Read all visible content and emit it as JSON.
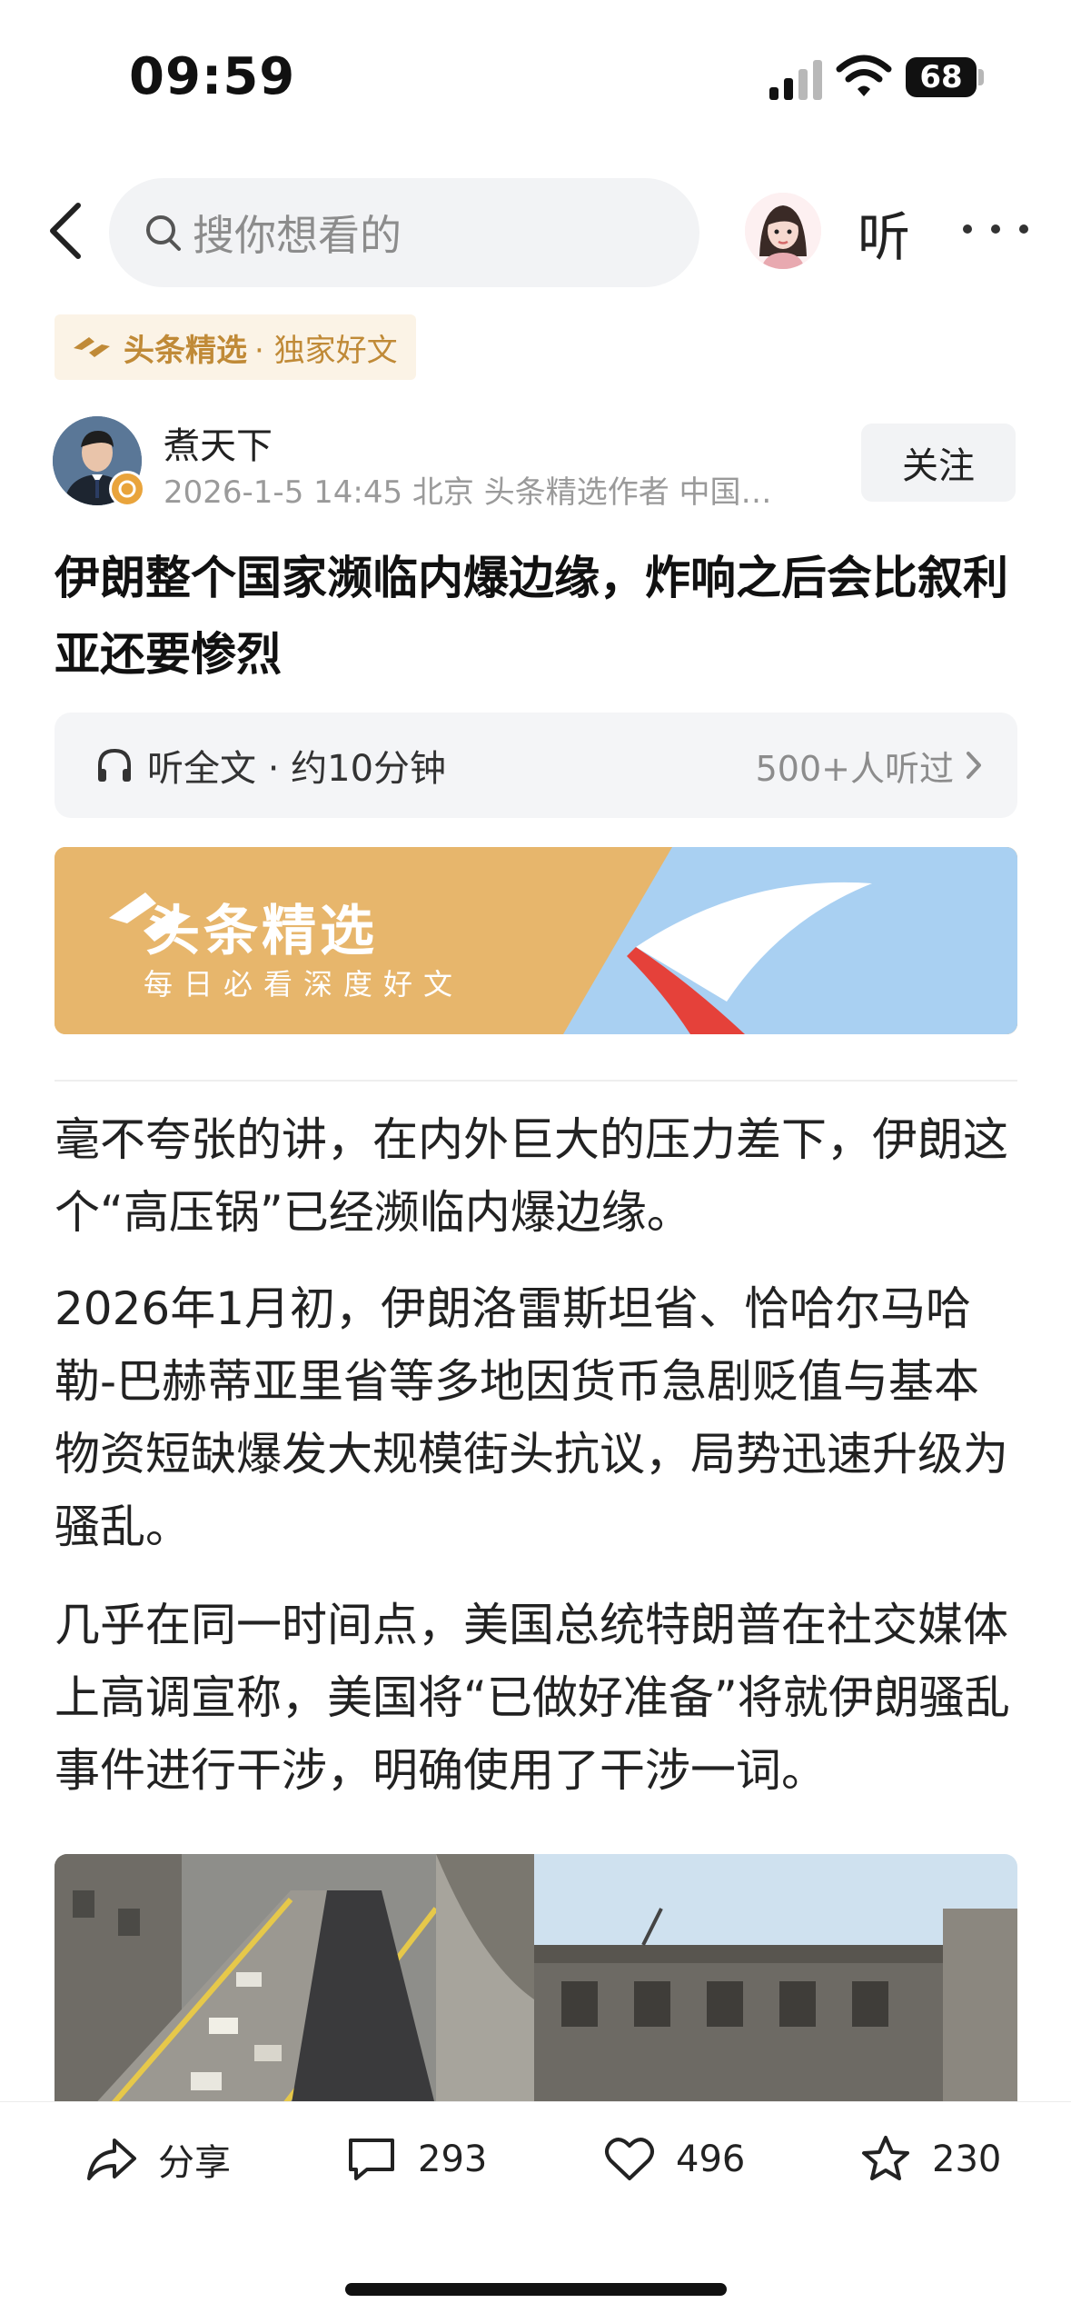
{
  "status_bar": {
    "time": "09:59",
    "battery": "68"
  },
  "nav": {
    "search_placeholder": "搜你想看的",
    "listen": "听"
  },
  "tag": {
    "brand": "头条精选",
    "sub": "· 独家好文"
  },
  "author": {
    "name": "煮天下",
    "meta": "2026-1-5  14:45  北京  头条精选作者 中国…",
    "follow": "关注"
  },
  "article": {
    "title": "伊朗整个国家濒临内爆边缘，炸响之后会比叙利亚还要惨烈",
    "listen_label": "听全文 · 约10分钟",
    "listen_count": "500+人听过",
    "banner_title": "头条精选",
    "banner_sub": "每日必看深度好文",
    "paragraphs": [
      "毫不夸张的讲，在内外巨大的压力差下，伊朗这个“高压锅”已经濒临内爆边缘。",
      "2026年1月初，伊朗洛雷斯坦省、恰哈尔马哈勒-巴赫蒂亚里省等多地因货币急剧贬值与基本物资短缺爆发大规模街头抗议，局势迅速升级为骚乱。",
      "几乎在同一时间点，美国总统特朗普在社交媒体上高调宣称，美国将“已做好准备”将就伊朗骚乱事件进行干涉，明确使用了干涉一词。"
    ]
  },
  "actions": {
    "share": "分享",
    "comments": "293",
    "likes": "496",
    "favorites": "230"
  },
  "colors": {
    "brand_gold": "#c08a37",
    "banner_gold": "#e7b66c",
    "banner_blue": "#a9d0f2",
    "banner_red": "#e5413a"
  },
  "icons": [
    "signal-icon",
    "wifi-icon",
    "back-arrow-icon",
    "search-icon",
    "more-dots-icon",
    "headphones-icon",
    "chevron-right-icon",
    "share-icon",
    "comment-icon",
    "heart-icon",
    "star-icon"
  ]
}
